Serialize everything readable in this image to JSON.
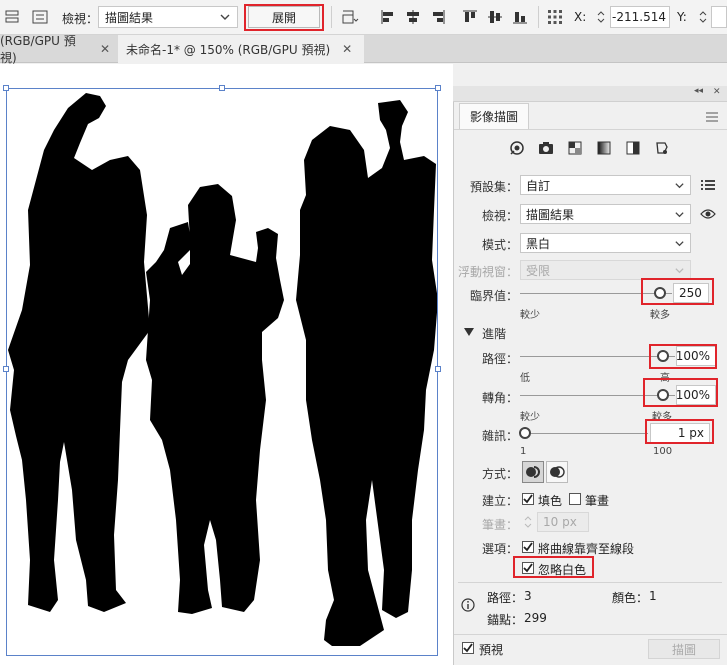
{
  "toolbar": {
    "view_label": "檢視：",
    "view_value": "描圖結果",
    "expand_label": "展開",
    "x_label": "X:",
    "x_value": "-211.514",
    "y_label": "Y:"
  },
  "tabs": [
    {
      "label": "(RGB/GPU 預視)",
      "close": "✕"
    },
    {
      "label": "未命名-1* @ 150% (RGB/GPU 預視)",
      "close": "✕"
    }
  ],
  "panel": {
    "collapse_glyph": "◂◂",
    "close_glyph": "✕",
    "title": "影像描圖",
    "preset_label": "預設集：",
    "preset_value": "自訂",
    "view_label": "檢視：",
    "view_value": "描圖結果",
    "mode_label": "模式：",
    "mode_value": "黑白",
    "palette_label": "浮動視窗：",
    "palette_value": "受限",
    "threshold_label": "臨界值：",
    "threshold_value": "250",
    "threshold_level": 250,
    "threshold_range": [
      0,
      255
    ],
    "threshold_min": "較少",
    "threshold_max": "較多",
    "advanced_label": "進階",
    "paths_label": "路徑：",
    "paths_value": "100%",
    "paths_level": 100,
    "paths_min": "低",
    "paths_max": "高",
    "corners_label": "轉角：",
    "corners_value": "100%",
    "corners_level": 100,
    "corners_min": "較少",
    "corners_max": "較多",
    "noise_label": "雜訊：",
    "noise_value": "1 px",
    "noise_level": 1,
    "noise_min": "1",
    "noise_max": "100",
    "method_label": "方式：",
    "create_label": "建立：",
    "fill_label": "填色",
    "fill_checked": true,
    "stroke_label": "筆畫",
    "stroke_checked": false,
    "stroke_width_label": "筆畫：",
    "stroke_width_value": "10 px",
    "options_label": "選項：",
    "snap_label": "將曲線靠齊至線段",
    "snap_checked": true,
    "ignore_white_label": "忽略白色",
    "ignore_white_checked": true,
    "stats_paths_label": "路徑：",
    "stats_paths_value": "3",
    "stats_colors_label": "顏色：",
    "stats_colors_value": "1",
    "stats_anchors_label": "錨點：",
    "stats_anchors_value": "299",
    "preview_label": "預視",
    "preview_checked": true,
    "trace_label": "描圖"
  },
  "colors": {
    "highlight": "#e0242b",
    "selection": "#5b82c9",
    "silhouette": "#000000"
  }
}
